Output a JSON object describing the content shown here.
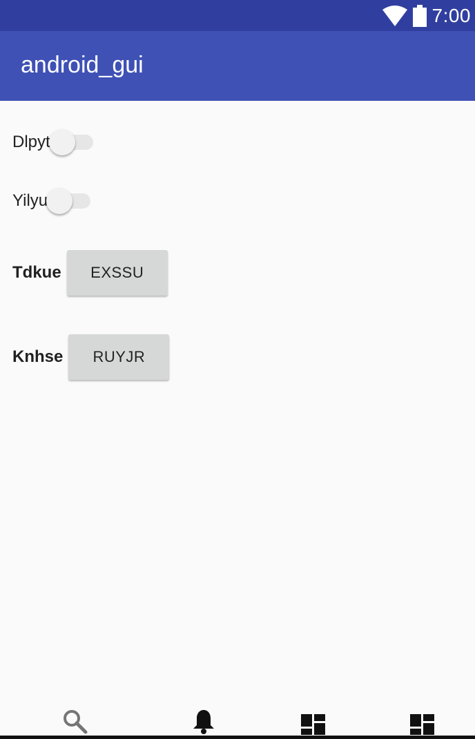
{
  "status_bar": {
    "time": "7:00",
    "icons": [
      "wifi-icon",
      "battery-icon"
    ]
  },
  "app_bar": {
    "title": "android_gui"
  },
  "rows": [
    {
      "label": "Dlpyt",
      "type": "switch",
      "checked": false
    },
    {
      "label": "Yilyu",
      "type": "switch",
      "checked": false
    },
    {
      "label": "Tdkue",
      "type": "button",
      "button_label": "EXSSU"
    },
    {
      "label": "Knhse",
      "type": "button",
      "button_label": "RUYJR"
    }
  ],
  "bottom_nav": {
    "items": [
      "search-icon",
      "bell-icon",
      "dashboard-icon",
      "dashboard-icon"
    ]
  },
  "colors": {
    "status_bar": "#303f9f",
    "app_bar": "#3f51b5",
    "background": "#fafafa",
    "button": "#d6d7d7"
  }
}
